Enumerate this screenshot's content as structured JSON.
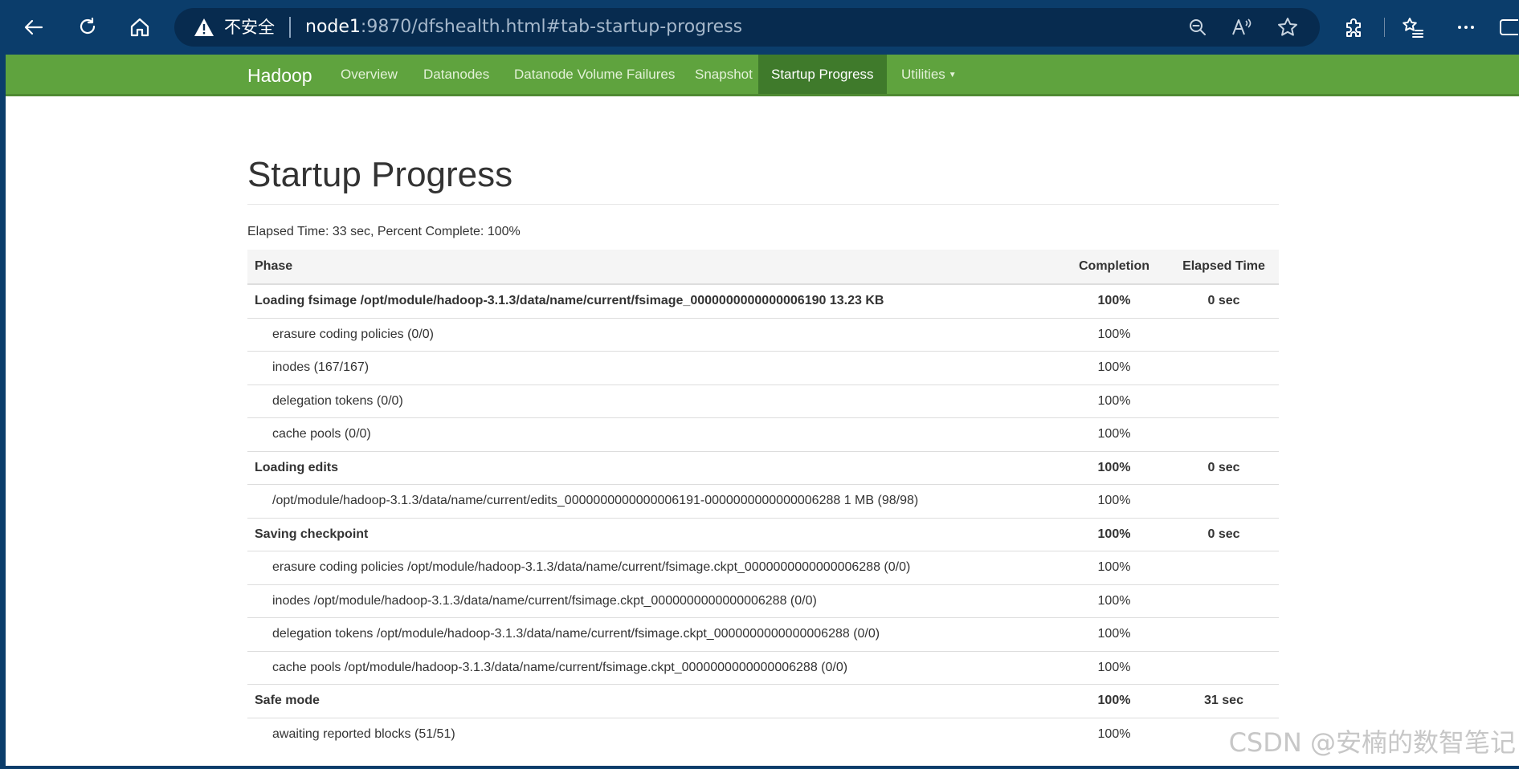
{
  "browser": {
    "security_label": "不安全",
    "url_host": "node1",
    "url_path": ":9870/dfshealth.html#tab-startup-progress"
  },
  "nav": {
    "brand": "Hadoop",
    "items": [
      {
        "label": "Overview"
      },
      {
        "label": "Datanodes"
      },
      {
        "label": "Datanode Volume Failures"
      },
      {
        "label": "Snapshot"
      },
      {
        "label": "Startup Progress",
        "active": true
      },
      {
        "label": "Utilities"
      }
    ]
  },
  "page": {
    "title": "Startup Progress",
    "summary": "Elapsed Time: 33 sec, Percent Complete: 100%"
  },
  "table": {
    "headers": {
      "phase": "Phase",
      "completion": "Completion",
      "elapsed": "Elapsed Time"
    },
    "rows": [
      {
        "type": "phase",
        "name": "Loading fsimage /opt/module/hadoop-3.1.3/data/name/current/fsimage_0000000000000006190 13.23 KB",
        "completion": "100%",
        "elapsed": "0 sec"
      },
      {
        "type": "step",
        "name": "erasure coding policies (0/0)",
        "completion": "100%",
        "elapsed": ""
      },
      {
        "type": "step",
        "name": "inodes (167/167)",
        "completion": "100%",
        "elapsed": ""
      },
      {
        "type": "step",
        "name": "delegation tokens (0/0)",
        "completion": "100%",
        "elapsed": ""
      },
      {
        "type": "step",
        "name": "cache pools (0/0)",
        "completion": "100%",
        "elapsed": ""
      },
      {
        "type": "phase",
        "name": "Loading edits",
        "completion": "100%",
        "elapsed": "0 sec"
      },
      {
        "type": "step",
        "name": "/opt/module/hadoop-3.1.3/data/name/current/edits_0000000000000006191-0000000000000006288 1 MB (98/98)",
        "completion": "100%",
        "elapsed": ""
      },
      {
        "type": "phase",
        "name": "Saving checkpoint",
        "completion": "100%",
        "elapsed": "0 sec"
      },
      {
        "type": "step",
        "name": "erasure coding policies /opt/module/hadoop-3.1.3/data/name/current/fsimage.ckpt_0000000000000006288 (0/0)",
        "completion": "100%",
        "elapsed": ""
      },
      {
        "type": "step",
        "name": "inodes /opt/module/hadoop-3.1.3/data/name/current/fsimage.ckpt_0000000000000006288 (0/0)",
        "completion": "100%",
        "elapsed": ""
      },
      {
        "type": "step",
        "name": "delegation tokens /opt/module/hadoop-3.1.3/data/name/current/fsimage.ckpt_0000000000000006288 (0/0)",
        "completion": "100%",
        "elapsed": ""
      },
      {
        "type": "step",
        "name": "cache pools /opt/module/hadoop-3.1.3/data/name/current/fsimage.ckpt_0000000000000006288 (0/0)",
        "completion": "100%",
        "elapsed": ""
      },
      {
        "type": "phase",
        "name": "Safe mode",
        "completion": "100%",
        "elapsed": "31 sec"
      },
      {
        "type": "step",
        "name": "awaiting reported blocks (51/51)",
        "completion": "100%",
        "elapsed": ""
      }
    ]
  },
  "watermark": "CSDN @安楠的数智笔记"
}
